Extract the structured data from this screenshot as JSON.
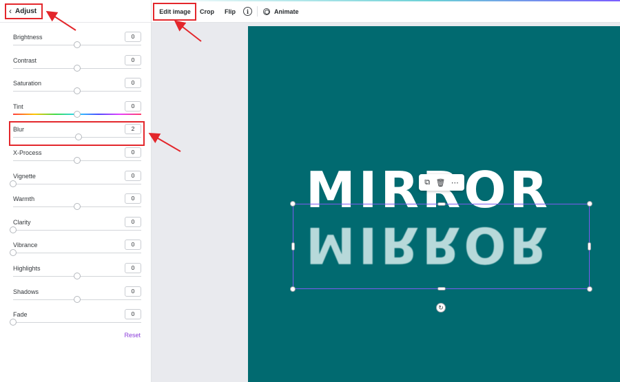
{
  "panel": {
    "back_label": "Adjust",
    "back_icon": "chevron-left-icon",
    "reset_label": "Reset",
    "adjustments": [
      {
        "id": "brightness",
        "label": "Brightness",
        "value": "0",
        "level": 0.5
      },
      {
        "id": "contrast",
        "label": "Contrast",
        "value": "0",
        "level": 0.5
      },
      {
        "id": "saturation",
        "label": "Saturation",
        "value": "0",
        "level": 0.5
      },
      {
        "id": "tint",
        "label": "Tint",
        "value": "0",
        "level": 0.5
      },
      {
        "id": "blur",
        "label": "Blur",
        "value": "2",
        "level": 0.51
      },
      {
        "id": "x-process",
        "label": "X-Process",
        "value": "0",
        "level": 0.5
      },
      {
        "id": "vignette",
        "label": "Vignette",
        "value": "0",
        "level": 0.0
      },
      {
        "id": "warmth",
        "label": "Warmth",
        "value": "0",
        "level": 0.5
      },
      {
        "id": "clarity",
        "label": "Clarity",
        "value": "0",
        "level": 0.0
      },
      {
        "id": "vibrance",
        "label": "Vibrance",
        "value": "0",
        "level": 0.0
      },
      {
        "id": "highlights",
        "label": "Highlights",
        "value": "0",
        "level": 0.5
      },
      {
        "id": "shadows",
        "label": "Shadows",
        "value": "0",
        "level": 0.5
      },
      {
        "id": "fade",
        "label": "Fade",
        "value": "0",
        "level": 0.0
      }
    ]
  },
  "toolbar": {
    "edit_image": "Edit image",
    "crop": "Crop",
    "flip": "Flip",
    "info_icon": "i",
    "animate": "Animate"
  },
  "canvas": {
    "background_color": "#016a70",
    "word": "MIRROR",
    "reflection": "MIRROR",
    "float_menu": {
      "duplicate_icon": "duplicate-icon",
      "delete_icon": "trash-icon",
      "more_icon": "more-icon"
    }
  },
  "colors": {
    "accent": "#8a3cd9",
    "selection": "#7d5bf0",
    "annotation": "#e3262b"
  }
}
